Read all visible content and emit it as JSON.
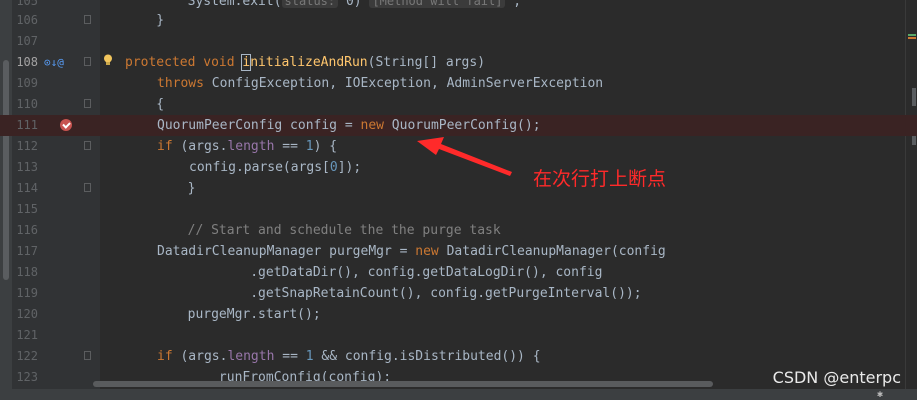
{
  "editor": {
    "lines": [
      {
        "num": "105"
      },
      {
        "num": "106",
        "text": "    }"
      },
      {
        "num": "107",
        "text": ""
      },
      {
        "num": "108"
      },
      {
        "num": "109",
        "text": ""
      },
      {
        "num": "110",
        "text": "    {"
      },
      {
        "num": "111"
      },
      {
        "num": "112"
      },
      {
        "num": "113"
      },
      {
        "num": "114",
        "text": "        }"
      },
      {
        "num": "115",
        "text": ""
      },
      {
        "num": "116",
        "text": "        // Start and schedule the the purge task"
      },
      {
        "num": "117"
      },
      {
        "num": "118",
        "text": "                .getDataDir(), config.getDataLogDir(), config"
      },
      {
        "num": "119",
        "text": "                .getSnapRetainCount(), config.getPurgeInterval());"
      },
      {
        "num": "120",
        "text": "        purgeMgr.start();"
      },
      {
        "num": "121",
        "text": ""
      },
      {
        "num": "122"
      },
      {
        "num": "123",
        "text": "            runFromConfig(config);"
      }
    ],
    "tokens": {
      "l105_a": "        System.exit(",
      "l105_hint": "status:",
      "l105_b": " 0) ",
      "l105_hint2": "[Method will fail]",
      "l105_c": " ;",
      "l108_kw": "protected void ",
      "l108_caret": "i",
      "l108_fn": "nitializeAndRun",
      "l108_rest": "(String[] args)",
      "l109_kw": "throws",
      "l109_rest": " ConfigException, IOException, AdminServerException",
      "l111_a": "QuorumPeerConfig config = ",
      "l111_kw": "new",
      "l111_b": " QuorumPeerConfig();",
      "l112_kw": "if",
      "l112_a": " (args.",
      "l112_fld": "length",
      "l112_b": " == ",
      "l112_num": "1",
      "l112_c": ") {",
      "l113_a": "config.parse(args[",
      "l113_num": "0",
      "l113_b": "]);",
      "l117_a": "DatadirCleanupManager purgeMgr = ",
      "l117_kw": "new",
      "l117_b": " DatadirCleanupManager(config",
      "l122_kw": "if",
      "l122_a": " (args.",
      "l122_fld": "length",
      "l122_b": " == ",
      "l122_num": "1",
      "l122_c": " && config.isDistributed()) {"
    },
    "gutter_icons_108": "⊙↓@"
  },
  "annotation": {
    "text": "在次行打上断点",
    "color": "#ff2a2a"
  },
  "watermark": "CSDN @enterpc",
  "colors": {
    "keyword": "#cc7832",
    "function": "#ffc66d",
    "number": "#6897bb",
    "field": "#9876aa",
    "comment": "#808080",
    "text": "#a9b7c6",
    "breakpoint": "#c75450"
  }
}
